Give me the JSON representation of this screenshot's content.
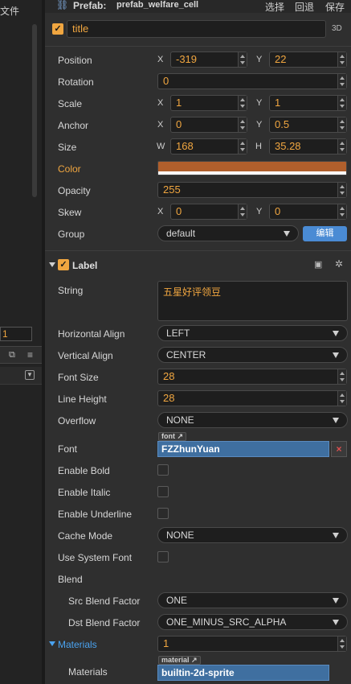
{
  "left_panel": {
    "top_text": "文件",
    "number_value": "1",
    "icon_a": "copy-icon",
    "icon_b": "menu-icon"
  },
  "header": {
    "prefab_label": "Prefab:",
    "prefab_name": "prefab_welfare_cell",
    "select_label": "选择",
    "revert_label": "回退",
    "save_label": "保存"
  },
  "node": {
    "name": "title",
    "mode_3d": "3D"
  },
  "node_props": {
    "position": {
      "label": "Position",
      "x_axis": "X",
      "y_axis": "Y",
      "x": "-319",
      "y": "22"
    },
    "rotation": {
      "label": "Rotation",
      "value": "0"
    },
    "scale": {
      "label": "Scale",
      "x_axis": "X",
      "y_axis": "Y",
      "x": "1",
      "y": "1"
    },
    "anchor": {
      "label": "Anchor",
      "x_axis": "X",
      "y_axis": "Y",
      "x": "0",
      "y": "0.5"
    },
    "size": {
      "label": "Size",
      "w_axis": "W",
      "h_axis": "H",
      "w": "168",
      "h": "35.28"
    },
    "color": {
      "label": "Color",
      "hex": "#b05f2c"
    },
    "opacity": {
      "label": "Opacity",
      "value": "255"
    },
    "skew": {
      "label": "Skew",
      "x_axis": "X",
      "y_axis": "Y",
      "x": "0",
      "y": "0"
    },
    "group": {
      "label": "Group",
      "value": "default",
      "edit_label": "编辑"
    }
  },
  "label_component": {
    "title": "Label",
    "string": {
      "label": "String",
      "value": "五星好评领豆"
    },
    "horizontal_align": {
      "label": "Horizontal Align",
      "value": "LEFT"
    },
    "vertical_align": {
      "label": "Vertical Align",
      "value": "CENTER"
    },
    "font_size": {
      "label": "Font Size",
      "value": "28"
    },
    "line_height": {
      "label": "Line Height",
      "value": "28"
    },
    "overflow": {
      "label": "Overflow",
      "value": "NONE"
    },
    "font": {
      "label": "Font",
      "tag": "font",
      "value": "FZZhunYuan",
      "clear": "×"
    },
    "enable_bold": {
      "label": "Enable Bold"
    },
    "enable_italic": {
      "label": "Enable Italic"
    },
    "enable_underline": {
      "label": "Enable Underline"
    },
    "cache_mode": {
      "label": "Cache Mode",
      "value": "NONE"
    },
    "use_system_font": {
      "label": "Use System Font"
    },
    "blend": {
      "label": "Blend"
    },
    "src_blend": {
      "label": "Src Blend Factor",
      "value": "ONE"
    },
    "dst_blend": {
      "label": "Dst Blend Factor",
      "value": "ONE_MINUS_SRC_ALPHA"
    },
    "materials": {
      "label": "Materials",
      "count": "1",
      "item_label": "Materials",
      "tag": "material",
      "item_value": "builtin-2d-sprite"
    }
  },
  "colors": {
    "accent": "#f0a640",
    "link_blue": "#4aa3f0",
    "edit_button": "#4a8bd4",
    "asset_field": "#3f6fa0"
  }
}
